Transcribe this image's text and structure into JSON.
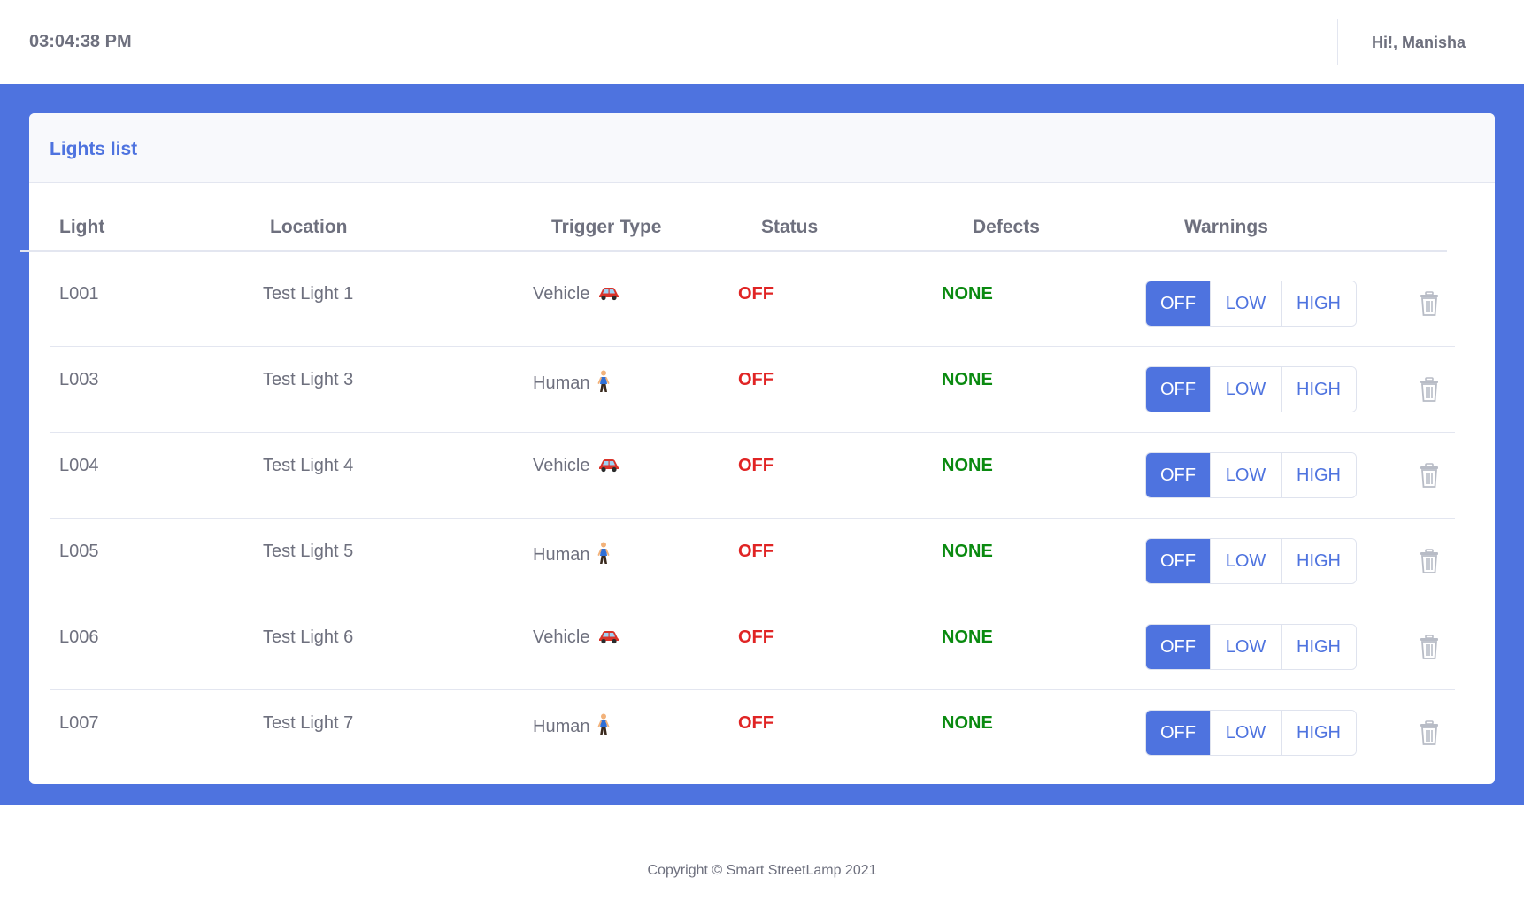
{
  "topbar": {
    "time": "03:04:38 PM",
    "greeting": "Hi!, Manisha"
  },
  "card": {
    "title": "Lights list"
  },
  "table": {
    "headers": {
      "light": "Light",
      "location": "Location",
      "trigger": "Trigger Type",
      "status": "Status",
      "defects": "Defects",
      "warnings": "Warnings"
    },
    "warning_options": [
      "OFF",
      "LOW",
      "HIGH"
    ],
    "rows": [
      {
        "light": "L001",
        "location": "Test Light 1",
        "trigger": "Vehicle",
        "trigger_icon": "car-icon",
        "status": "OFF",
        "defects": "NONE",
        "warning": "OFF"
      },
      {
        "light": "L003",
        "location": "Test Light 3",
        "trigger": "Human",
        "trigger_icon": "person-walking-icon",
        "status": "OFF",
        "defects": "NONE",
        "warning": "OFF"
      },
      {
        "light": "L004",
        "location": "Test Light 4",
        "trigger": "Vehicle",
        "trigger_icon": "car-icon",
        "status": "OFF",
        "defects": "NONE",
        "warning": "OFF"
      },
      {
        "light": "L005",
        "location": "Test Light 5",
        "trigger": "Human",
        "trigger_icon": "person-walking-icon",
        "status": "OFF",
        "defects": "NONE",
        "warning": "OFF"
      },
      {
        "light": "L006",
        "location": "Test Light 6",
        "trigger": "Vehicle",
        "trigger_icon": "car-icon",
        "status": "OFF",
        "defects": "NONE",
        "warning": "OFF"
      },
      {
        "light": "L007",
        "location": "Test Light 7",
        "trigger": "Human",
        "trigger_icon": "person-walking-icon",
        "status": "OFF",
        "defects": "NONE",
        "warning": "OFF"
      }
    ]
  },
  "footer": {
    "copyright": "Copyright © Smart StreetLamp 2021"
  },
  "colors": {
    "primary": "#4e73df",
    "status_off": "#e02424",
    "defect_none": "#0a8a10",
    "muted_text": "#6e707e"
  }
}
